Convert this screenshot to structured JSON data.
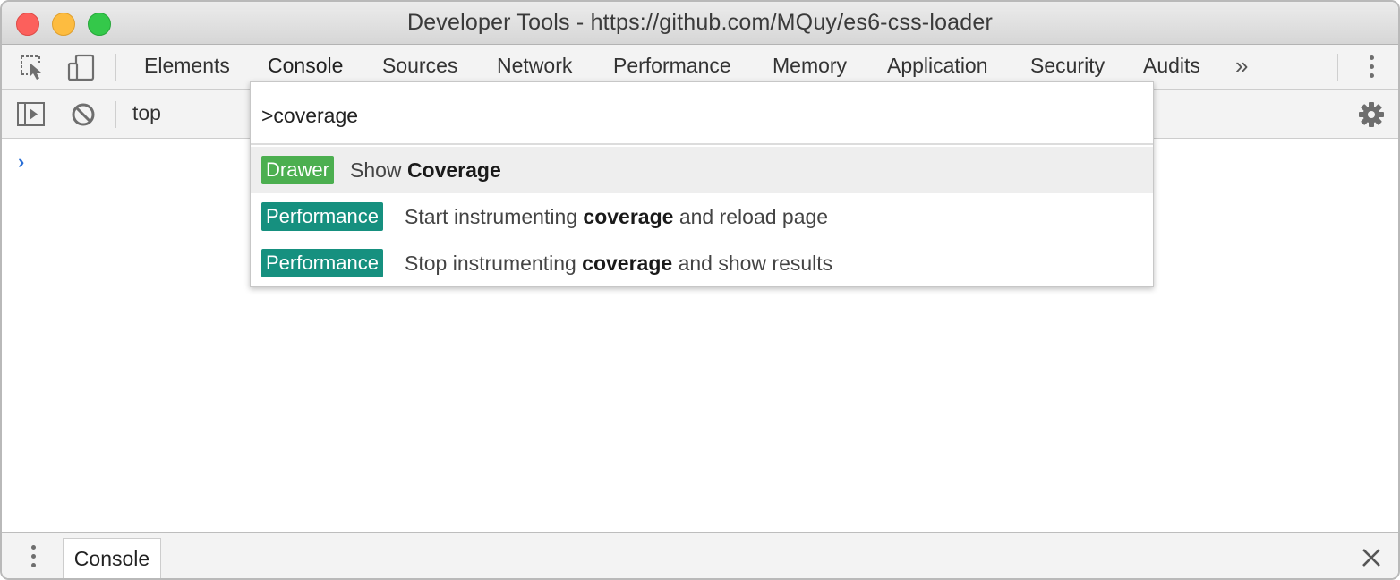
{
  "window": {
    "title": "Developer Tools - https://github.com/MQuy/es6-css-loader"
  },
  "toolbar": {
    "icons": [
      "inspect-element-icon",
      "device-toolbar-icon"
    ],
    "tabs": [
      {
        "label": "Elements",
        "active": false
      },
      {
        "label": "Console",
        "active": true
      },
      {
        "label": "Sources",
        "active": false
      },
      {
        "label": "Network",
        "active": false
      },
      {
        "label": "Performance",
        "active": false
      },
      {
        "label": "Memory",
        "active": false
      },
      {
        "label": "Application",
        "active": false
      },
      {
        "label": "Security",
        "active": false
      },
      {
        "label": "Audits",
        "active": false
      }
    ],
    "more_tabs": "»",
    "menu_icon": "kebab-menu-icon"
  },
  "console_bar": {
    "icons": [
      "show-sidebar-icon",
      "clear-console-icon",
      "settings-gear-icon"
    ],
    "context": "top"
  },
  "console": {
    "prompt": "›"
  },
  "command_menu": {
    "query": ">coverage",
    "items": [
      {
        "badge": "Drawer",
        "badge_color": "#4caf50",
        "prefix": "Show ",
        "match": "Coverage",
        "suffix": "",
        "selected": true
      },
      {
        "badge": "Performance",
        "badge_color": "#16907f",
        "prefix": "Start instrumenting ",
        "match": "coverage",
        "suffix": " and reload page",
        "selected": false
      },
      {
        "badge": "Performance",
        "badge_color": "#16907f",
        "prefix": "Stop instrumenting ",
        "match": "coverage",
        "suffix": " and show results",
        "selected": false
      }
    ]
  },
  "drawer": {
    "tab_label": "Console",
    "close_icon": "close-icon"
  }
}
